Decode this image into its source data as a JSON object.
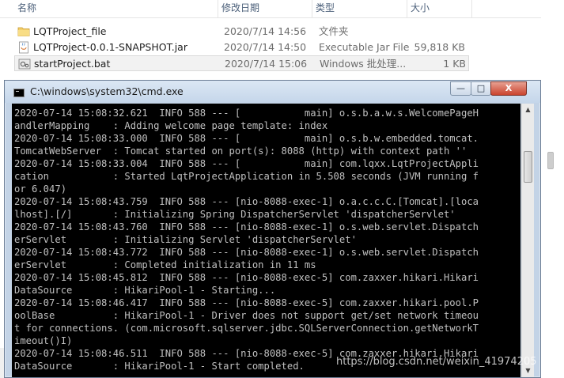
{
  "explorer": {
    "columns": {
      "name": "名称",
      "date": "修改日期",
      "type": "类型",
      "size": "大小"
    },
    "files": [
      {
        "name": "LQTProject_file",
        "date": "2020/7/14 14:56",
        "type": "文件夹",
        "size": "",
        "icon": "folder-icon"
      },
      {
        "name": "LQTProject-0.0.1-SNAPSHOT.jar",
        "date": "2020/7/14 14:50",
        "type": "Executable Jar File",
        "size": "59,818 KB",
        "icon": "jar-file-icon"
      },
      {
        "name": "startProject.bat",
        "date": "2020/7/14 15:06",
        "type": "Windows 批处理...",
        "size": "1 KB",
        "icon": "batch-file-icon"
      }
    ]
  },
  "console": {
    "title": "C:\\windows\\system32\\cmd.exe",
    "buttons": {
      "minimize": "—",
      "maximize": "□",
      "close": "X"
    },
    "lines": [
      "2020-07-14 15:08:32.621  INFO 588 --- [           main] o.s.b.a.w.s.WelcomePageH",
      "andlerMapping    : Adding welcome page template: index",
      "2020-07-14 15:08:33.000  INFO 588 --- [           main] o.s.b.w.embedded.tomcat.",
      "TomcatWebServer  : Tomcat started on port(s): 8088 (http) with context path ''",
      "2020-07-14 15:08:33.004  INFO 588 --- [           main] com.lqxx.LqtProjectAppli",
      "cation           : Started LqtProjectApplication in 5.508 seconds (JVM running f",
      "or 6.047)",
      "2020-07-14 15:08:43.759  INFO 588 --- [nio-8088-exec-1] o.a.c.c.C.[Tomcat].[loca",
      "lhost].[/]       : Initializing Spring DispatcherServlet 'dispatcherServlet'",
      "2020-07-14 15:08:43.760  INFO 588 --- [nio-8088-exec-1] o.s.web.servlet.Dispatch",
      "erServlet        : Initializing Servlet 'dispatcherServlet'",
      "2020-07-14 15:08:43.772  INFO 588 --- [nio-8088-exec-1] o.s.web.servlet.Dispatch",
      "erServlet        : Completed initialization in 11 ms",
      "2020-07-14 15:08:45.812  INFO 588 --- [nio-8088-exec-5] com.zaxxer.hikari.Hikari",
      "DataSource       : HikariPool-1 - Starting...",
      "2020-07-14 15:08:46.417  INFO 588 --- [nio-8088-exec-5] com.zaxxer.hikari.pool.P",
      "oolBase          : HikariPool-1 - Driver does not support get/set network timeou",
      "t for connections. (com.microsoft.sqlserver.jdbc.SQLServerConnection.getNetworkT",
      "imeout()I)",
      "2020-07-14 15:08:46.511  INFO 588 --- [nio-8088-exec-5] com.zaxxer.hikari.Hikari",
      "DataSource       : HikariPool-1 - Start completed."
    ]
  },
  "watermark": "https://blog.csdn.net/weixin_41974205"
}
